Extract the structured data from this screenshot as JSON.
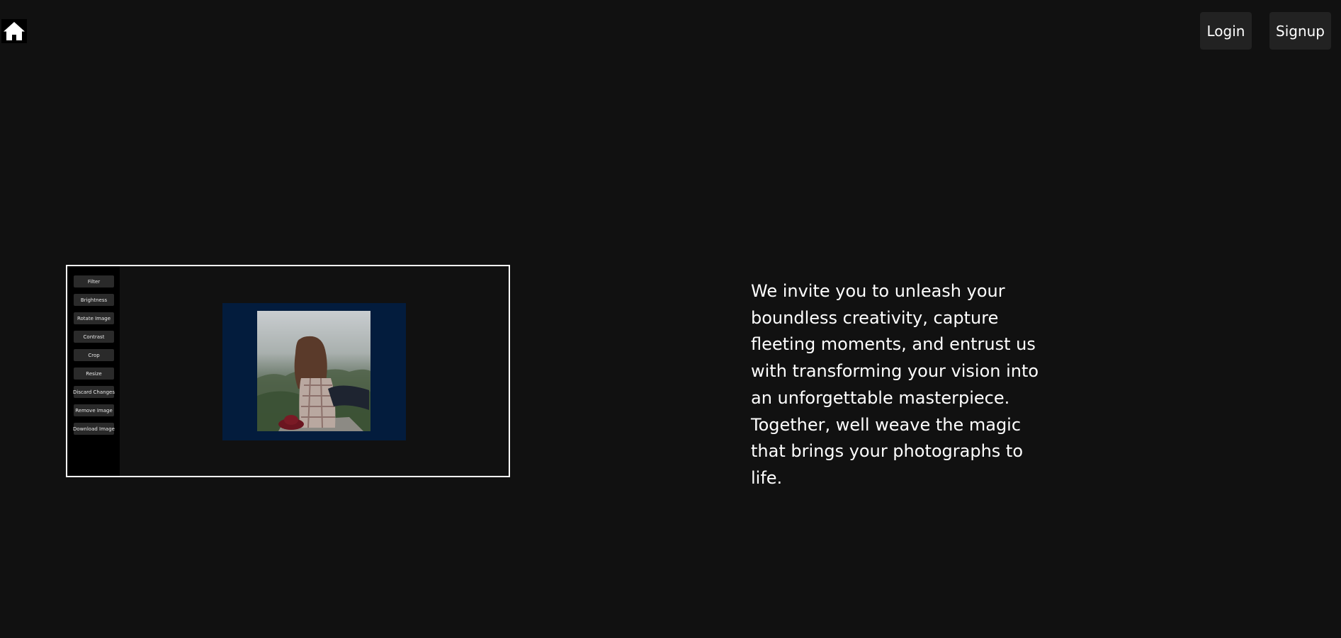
{
  "header": {
    "home_icon": "home-icon",
    "login_label": "Login",
    "signup_label": "Signup"
  },
  "preview": {
    "tools": [
      "Filter",
      "Brightness",
      "Rotate Image",
      "Contrast",
      "Crop",
      "Resize",
      "Discard Changes",
      "Remove Image",
      "Download Image"
    ],
    "canvas_color": "#031c3d"
  },
  "hero": {
    "tagline": "We invite you to unleash your boundless creativity, capture fleeting moments, and entrust us with transforming your vision into an unforgettable masterpiece. Together, well weave the magic that brings your photographs to life."
  },
  "colors": {
    "background": "#111111",
    "button_bg": "#222222",
    "text": "#ffffff"
  }
}
